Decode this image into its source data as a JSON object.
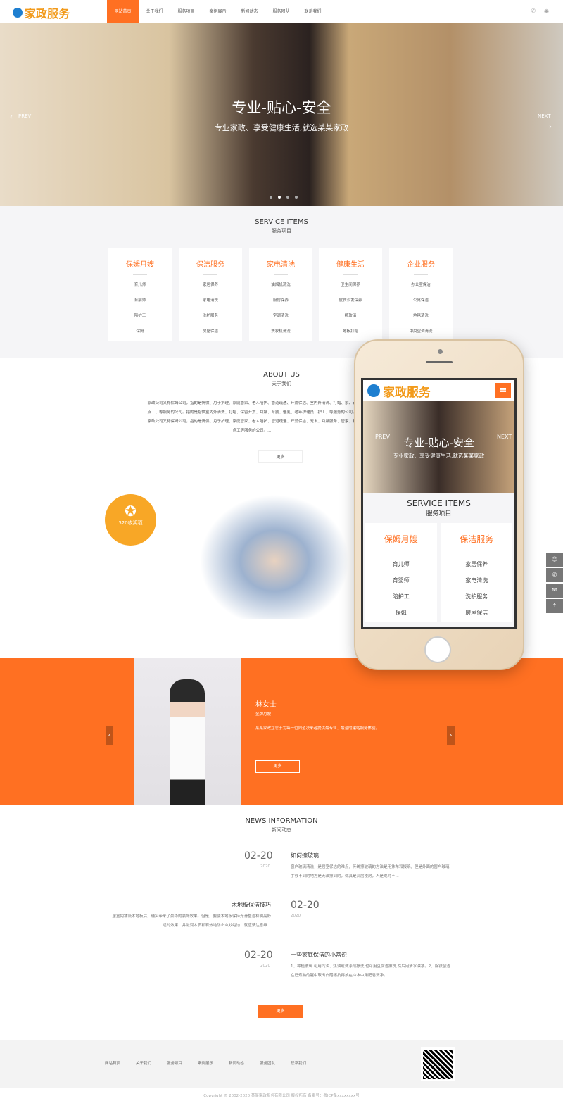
{
  "header": {
    "logo": "家政服务",
    "nav": [
      "网站首页",
      "关于我们",
      "服务项目",
      "案例展示",
      "新闻动态",
      "服务团队",
      "联系我们"
    ],
    "active": 0,
    "icons": [
      "phone-icon",
      "eye-icon"
    ]
  },
  "hero": {
    "title": "专业-贴心-安全",
    "subtitle": "专业家政、享受健康生活,就选某某家政",
    "prev": "PREV",
    "next": "NEXT",
    "slides": 4,
    "active_slide": 1
  },
  "services": {
    "en": "SERVICE ITEMS",
    "cn": "服务项目",
    "cards": [
      {
        "title": "保姆月嫂",
        "items": [
          "育儿师",
          "育婴师",
          "陪护工",
          "保姆"
        ]
      },
      {
        "title": "保洁服务",
        "items": [
          "家居保养",
          "家电清洗",
          "洗护服务",
          "房屋保洁"
        ]
      },
      {
        "title": "家电清洗",
        "items": [
          "油烟机清洗",
          "厨房保养",
          "空调清洗",
          "洗衣机清洗"
        ]
      },
      {
        "title": "健康生活",
        "items": [
          "卫生间保养",
          "皮质沙发保养",
          "擦玻璃",
          "地板打蜡"
        ]
      },
      {
        "title": "企业服务",
        "items": [
          "办公室保洁",
          "公寓保洁",
          "地毯清洗",
          "中央空调清洗"
        ]
      }
    ]
  },
  "about": {
    "en": "ABOUT US",
    "cn": "关于我们",
    "text": "家政公司又称保姆公司，指的是情供、月子护理、家庭管家、老人陪护、管道疏通、开荒保洁、室内外清洗、打蜡、家、钟点工、等服务的公司。指的是指供室内外清洗、打蜡、保留开荒、月嫂、育婴、催乳、老年护理员、护工、等服务的公司。家政公司又称保姆公司，指的是情供、月子护理、家庭管家、老人陪护、管道疏通、开荒保洁、宠发、月嫂服务、管家、钟点工等服务的公司。...",
    "more": "更多",
    "badge": "320枚奖项"
  },
  "team": {
    "name": "林女士",
    "role": "金牌月嫂",
    "desc": "某某家政立志于为每一位同道决来者提供最专业、最温的建站服务体验。...",
    "more": "更多"
  },
  "news": {
    "en": "NEWS INFORMATION",
    "cn": "新闻动态",
    "items": [
      {
        "date": "02-20",
        "year": "2020",
        "title": "如何擦玻璃",
        "desc": "窗户玻璃清洗，是居室保洁的难点，传统擦玻璃的方法是用抹布和报纸，但是外面的窗户玻璃手够不到的地方是无法擦到的，优其是高层楼房，人是绝对不..."
      },
      {
        "date": "02-20",
        "year": "2020",
        "title": "木地板保洁技巧",
        "desc": "居室内铺设木地板后，确实带来了豪华的装饰效果。但是，要使木地板保持光滑整洁和明亮舒适的效果，并滋润木质和有效地防止虫蚊蛀蚀，就应该注意维..."
      },
      {
        "date": "02-20",
        "year": "2020",
        "title": "一些家庭保洁的小常识",
        "desc": "1、种植玻璃 可用汽油、煤油或洗涤剂擦洗,也可用豆腐渣擦洗,然后用清水漂净。2、除铁窗渣 在已煮熟的腥中取出白醋擦抗再放在冷水中用肥皂洗净。..."
      }
    ],
    "more": "更多"
  },
  "footer": {
    "nav": [
      "网站首页",
      "关于我们",
      "服务项目",
      "案例展示",
      "新闻动态",
      "服务团队",
      "联系我们"
    ],
    "copyright": "Copyright © 2002-2020 某某家政服务有限公司 版权所有 备案号：粤ICP备xxxxxxxx号"
  },
  "sidebar": {
    "icons": [
      "qq-icon",
      "phone-icon",
      "wechat-icon",
      "back-to-top-icon"
    ]
  },
  "phone_preview": {
    "logo": "家政服务",
    "title": "专业-贴心-安全",
    "subtitle": "专业家政、享受健康生活,就选某某家政",
    "prev": "PREV",
    "next": "NEXT",
    "en": "SERVICE ITEMS",
    "cn": "服务项目",
    "cards": [
      {
        "title": "保姆月嫂",
        "items": [
          "育儿师",
          "育婴师",
          "陪护工",
          "保姆"
        ]
      },
      {
        "title": "保洁服务",
        "items": [
          "家居保养",
          "家电清洗",
          "洗护服务",
          "房屋保洁"
        ]
      }
    ]
  },
  "colors": {
    "accent": "#ff7022",
    "logo": "#f29a1a",
    "badge": "#f8a726"
  }
}
